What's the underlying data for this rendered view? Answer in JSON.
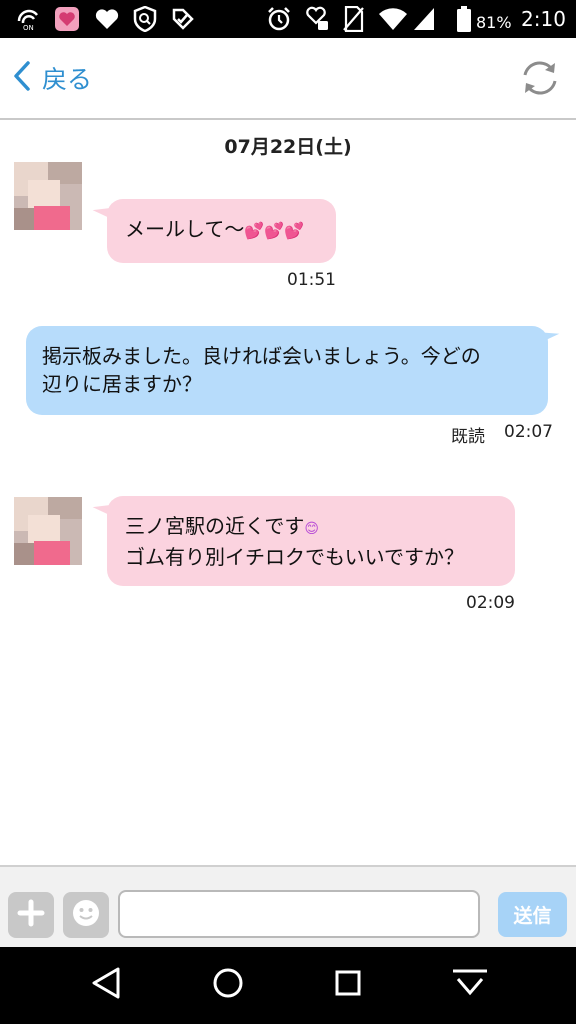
{
  "status_bar": {
    "battery_percent": "81%",
    "time": "2:10",
    "icons": [
      "nfc-on-icon",
      "app-heart-icon",
      "heart-icon",
      "shield-search-icon",
      "check-shield-icon",
      "alarm-icon",
      "heart-key-icon",
      "sim-off-icon",
      "wifi-icon",
      "signal-icon",
      "battery-icon"
    ]
  },
  "header": {
    "back_label": "戻る",
    "refresh_icon": "refresh-icon"
  },
  "chat": {
    "date": "07月22日(土)",
    "messages": [
      {
        "side": "incoming",
        "text": "メールして〜",
        "emoji": "💕💕💕",
        "time": "01:51"
      },
      {
        "side": "outgoing",
        "line1": "掲示板みました。良ければ会いましょう。今どの",
        "line2": "辺りに居ますか？",
        "read_label": "既読",
        "time": "02:07"
      },
      {
        "side": "incoming",
        "line1": "三ノ宮駅の近くです",
        "line1_emoji": "😊",
        "line2": "ゴム有り別イチロクでもいいですか？",
        "time": "02:09"
      }
    ]
  },
  "input_bar": {
    "placeholder": "",
    "send_label": "送信"
  },
  "colors": {
    "accent": "#2f8fd0",
    "incoming_bubble": "#fbd3df",
    "outgoing_bubble": "#b7dcfb",
    "send_button": "#a7d3f7"
  }
}
